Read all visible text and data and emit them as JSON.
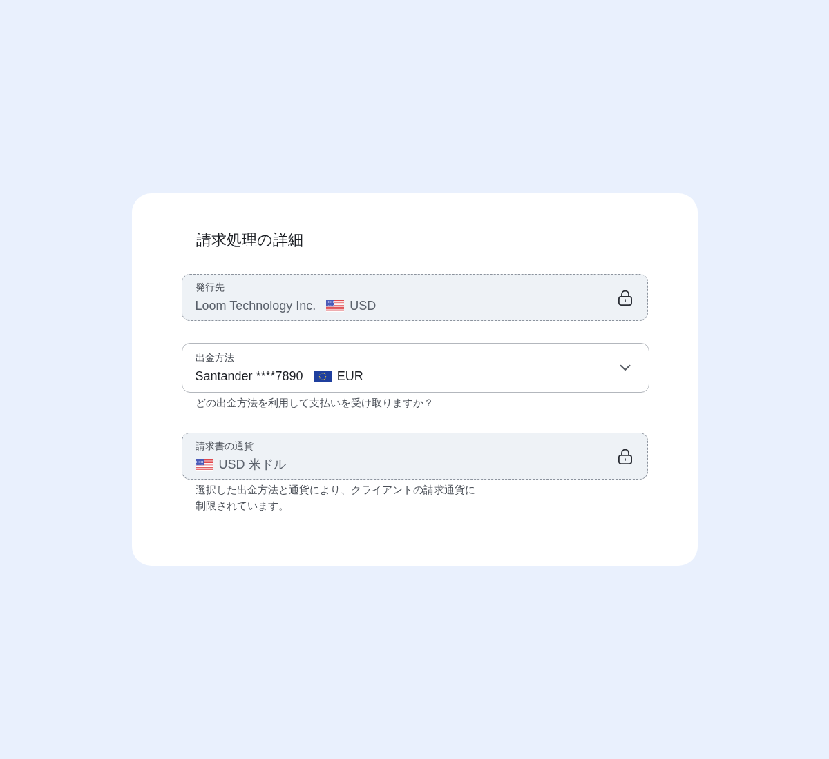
{
  "card": {
    "title": "請求処理の詳細"
  },
  "fields": [
    {
      "kind": "locked",
      "label": "発行先",
      "parts": [
        {
          "kind": "text",
          "text": "Loom Technology Inc."
        },
        {
          "kind": "usflag"
        },
        {
          "kind": "text",
          "text": "USD"
        }
      ]
    },
    {
      "kind": "select",
      "label": "出金方法",
      "parts": [
        {
          "kind": "text",
          "text": "Santander ****7890"
        },
        {
          "kind": "euflag"
        },
        {
          "kind": "text",
          "text": "EUR"
        }
      ],
      "helper": "どの出金方法を利用して支払いを受け取りますか？"
    },
    {
      "kind": "locked",
      "label": "請求書の通貨",
      "parts": [
        {
          "kind": "usflag"
        },
        {
          "kind": "text",
          "text": "USD 米ドル"
        }
      ],
      "helper": "選択した出金方法と通貨により、クライアントの請求通貨に制限されています。"
    }
  ]
}
